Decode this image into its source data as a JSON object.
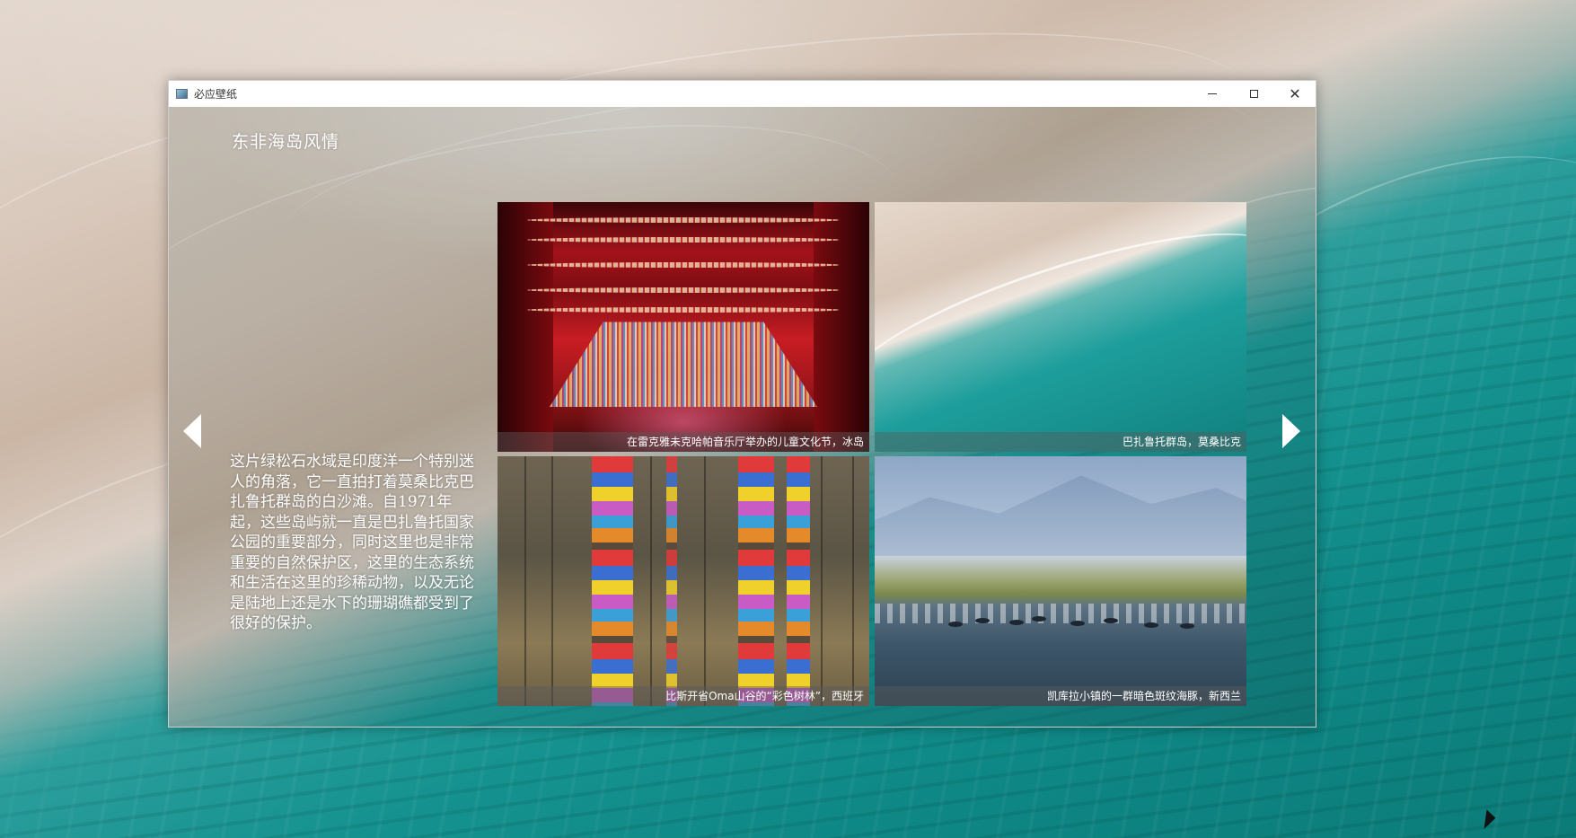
{
  "window": {
    "title": "必应壁纸"
  },
  "window_controls": {
    "minimize": "minimize",
    "maximize": "maximize",
    "close": "close"
  },
  "main": {
    "heading": "东非海岛风情",
    "description": "这片绿松石水域是印度洋一个特别迷人的角落，它一直拍打着莫桑比克巴扎鲁托群岛的白沙滩。自1971年起，这些岛屿就一直是巴扎鲁托国家公园的重要部分，同时这里也是非常重要的自然保护区，这里的生态系统和生活在这里的珍稀动物，以及无论是陆地上还是水下的珊瑚礁都受到了很好的保护。"
  },
  "gallery": {
    "items": [
      {
        "caption": "在雷克雅未克哈帕音乐厅举办的儿童文化节，冰岛"
      },
      {
        "caption": "巴扎鲁托群岛，莫桑比克"
      },
      {
        "caption": "比斯开省Oma山谷的“彩色树林”，西班牙"
      },
      {
        "caption": "凯库拉小镇的一群暗色斑纹海豚，新西兰"
      }
    ]
  },
  "navigation": {
    "prev_icon": "chevron-left-icon",
    "next_icon": "chevron-right-icon"
  },
  "colors": {
    "sea": "#179592",
    "sand": "#d8c8ba",
    "caption_bg": "rgba(90,90,90,0.45)"
  }
}
